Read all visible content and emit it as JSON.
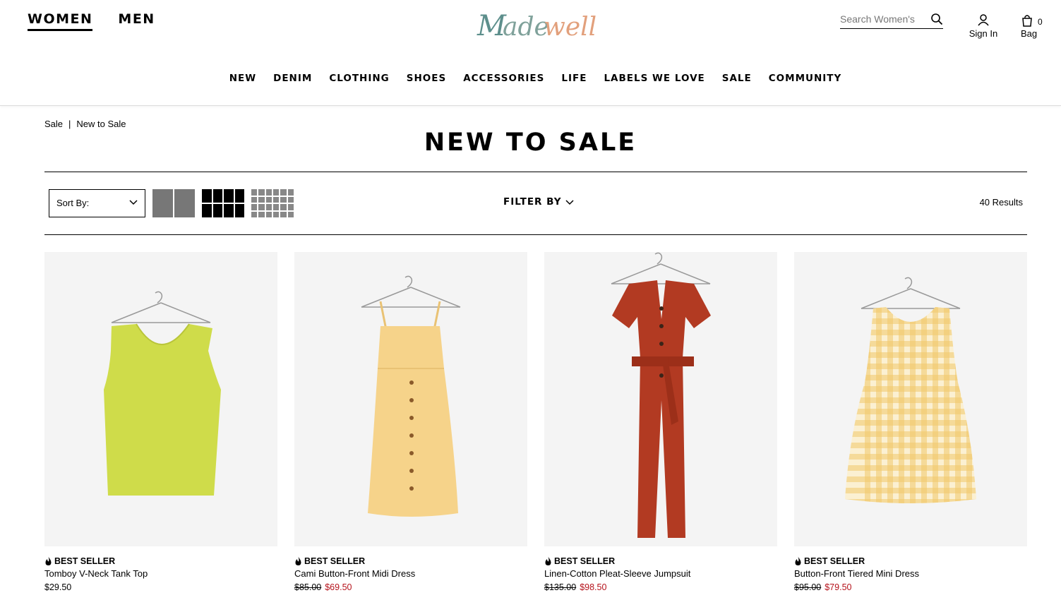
{
  "header": {
    "gender_tabs": [
      {
        "label": "WOMEN"
      },
      {
        "label": "MEN"
      }
    ],
    "logo_text": "Madewell",
    "search_placeholder": "Search Women's",
    "signin_label": "Sign In",
    "bag_label": "Bag",
    "bag_count": "0"
  },
  "nav": [
    {
      "label": "NEW"
    },
    {
      "label": "DENIM"
    },
    {
      "label": "CLOTHING"
    },
    {
      "label": "SHOES"
    },
    {
      "label": "ACCESSORIES"
    },
    {
      "label": "LIFE"
    },
    {
      "label": "LABELS WE LOVE"
    },
    {
      "label": "SALE"
    },
    {
      "label": "COMMUNITY"
    }
  ],
  "breadcrumb": {
    "root": "Sale",
    "sep": "|",
    "current": "New to Sale"
  },
  "page_title": "NEW TO SALE",
  "toolbar": {
    "sort_label": "Sort By:",
    "filter_label": "FILTER BY",
    "results": "40 Results"
  },
  "products": [
    {
      "badge": "BEST SELLER",
      "name": "Tomboy V-Neck Tank Top",
      "old_price": "",
      "price": "$29.50",
      "on_sale": false,
      "color": "#cfdc4a",
      "type": "tank"
    },
    {
      "badge": "BEST SELLER",
      "name": "Cami Button-Front Midi Dress",
      "old_price": "$85.00",
      "price": "$69.50",
      "on_sale": true,
      "color": "#f6d38a",
      "type": "cami"
    },
    {
      "badge": "BEST SELLER",
      "name": "Linen-Cotton Pleat-Sleeve Jumpsuit",
      "old_price": "$135.00",
      "price": "$98.50",
      "on_sale": true,
      "color": "#b23a22",
      "type": "jumpsuit"
    },
    {
      "badge": "BEST SELLER",
      "name": "Button-Front Tiered Mini Dress",
      "old_price": "$95.00",
      "price": "$79.50",
      "on_sale": true,
      "color": "#f1d58a",
      "type": "gingham"
    }
  ],
  "colors": {
    "sale_red": "#b5121b",
    "logo_teal": "#5d8f8c",
    "logo_peach": "#e2a07c"
  }
}
